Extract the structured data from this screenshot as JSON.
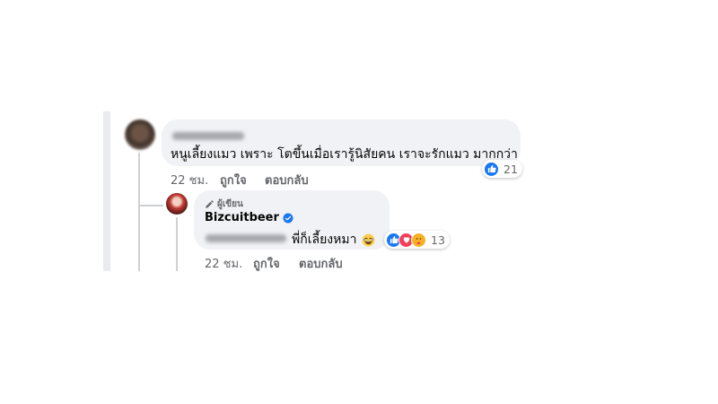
{
  "comment": {
    "text": "หนูเลี้ยงแมว เพราะ โตขึ้นเมื่อเรารู้นิสัยคน เราจะรักแมว มากกว่า",
    "time": "22 ชม.",
    "like_label": "ถูกใจ",
    "reply_label": "ตอบกลับ",
    "reaction_count": "21",
    "reaction_icons": [
      "like-icon"
    ]
  },
  "reply": {
    "author_badge": "ผู้เขียน",
    "name": "Bizcuitbeer",
    "text": "พี่ก็เลี้ยงหมา",
    "emoji": "laughing-emoji",
    "time": "22 ชม.",
    "like_label": "ถูกใจ",
    "reply_label": "ตอบกลับ",
    "reaction_count": "13",
    "reaction_icons": [
      "like-icon",
      "love-icon",
      "care-icon"
    ]
  },
  "colors": {
    "like": "#1877f2",
    "love": "#f33e58",
    "care": "#f7b125",
    "verified": "#1877f2",
    "bubble": "#f0f2f5",
    "meta_text": "#65676b"
  }
}
